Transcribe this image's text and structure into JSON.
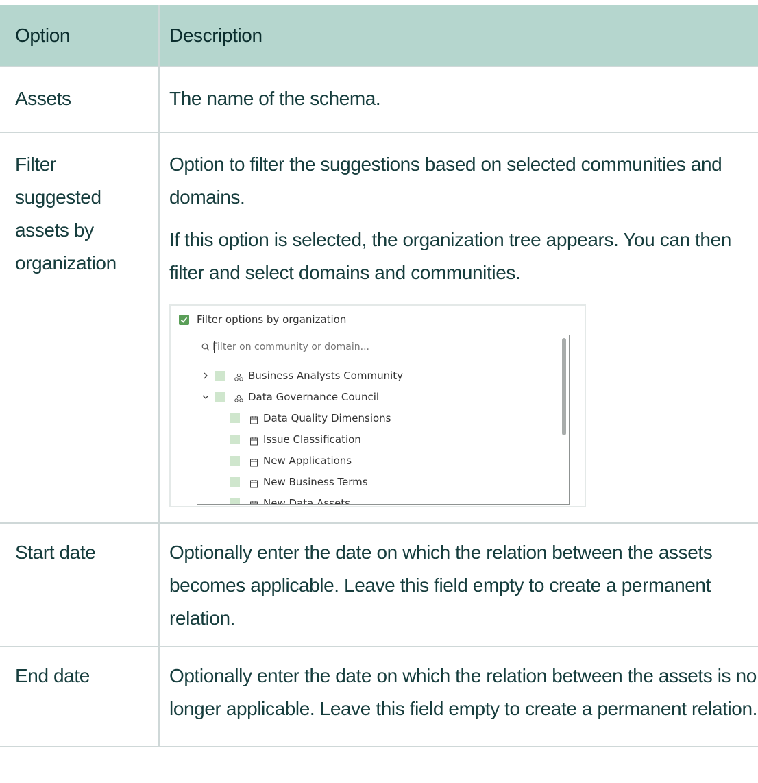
{
  "table": {
    "headers": [
      "Option",
      "Description"
    ],
    "rows": [
      {
        "option": "Assets",
        "description": [
          "The name of the schema."
        ]
      },
      {
        "option": "Filter suggested assets by organization",
        "description": [
          "Option to filter the suggestions based on selected communities and domains.",
          "If this option is selected, the organization tree appears. You can then filter and select domains and communities."
        ]
      },
      {
        "option": "Start date",
        "description": [
          "Optionally enter the date on which the relation between the assets becomes applicable. Leave this field empty to create a permanent relation."
        ]
      },
      {
        "option": "End date",
        "description": [
          "Optionally enter the date on which the relation between the assets is no longer applicable. Leave this field empty to create a permanent relation."
        ]
      }
    ]
  },
  "widget": {
    "checkbox_label": "Filter options by organization",
    "checked": true,
    "search_placeholder": "Filter on community or domain...",
    "tree": [
      {
        "label": "Business Analysts Community",
        "type": "community",
        "expanded": false,
        "level": 0
      },
      {
        "label": "Data Governance Council",
        "type": "community",
        "expanded": true,
        "level": 0
      },
      {
        "label": "Data Quality Dimensions",
        "type": "domain",
        "level": 1
      },
      {
        "label": "Issue Classification",
        "type": "domain",
        "level": 1
      },
      {
        "label": "New Applications",
        "type": "domain",
        "level": 1
      },
      {
        "label": "New Business Terms",
        "type": "domain",
        "level": 1
      },
      {
        "label": "New Data Assets",
        "type": "domain",
        "level": 1
      }
    ],
    "colors": {
      "check": "#5a9e58",
      "square": "#cfe6cd",
      "header_bg": "#b5d6ce"
    }
  }
}
